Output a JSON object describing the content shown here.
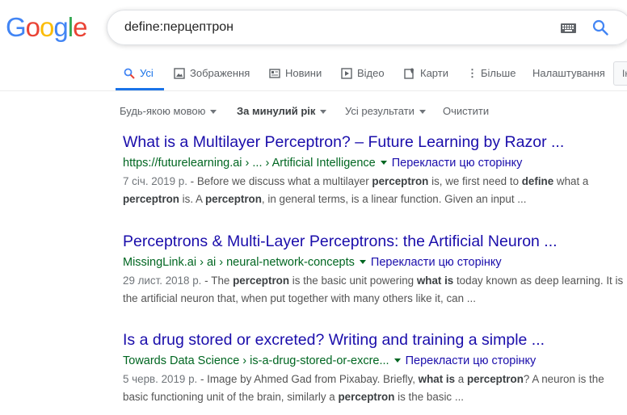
{
  "logo": [
    "G",
    "o",
    "o",
    "g",
    "l",
    "e"
  ],
  "logo_colors": [
    "#4285F4",
    "#EA4335",
    "#FBBC05",
    "#4285F4",
    "#34A853",
    "#EA4335"
  ],
  "search": {
    "query": "define:перцептрон"
  },
  "tabs": {
    "all": "Усі",
    "images": "Зображення",
    "news": "Новини",
    "video": "Відео",
    "maps": "Карти",
    "more": "Більше",
    "settings": "Налаштування",
    "tools": "Ін"
  },
  "filters": {
    "language": "Будь-якою мовою",
    "period": "За минулий рік",
    "results": "Усі результати",
    "clear": "Очистити"
  },
  "results": [
    {
      "title": "What is a Multilayer Perceptron? – Future Learning by Razor ...",
      "url": "https://futurelearning.ai › ... › Artificial Intelligence",
      "translate": "Перекласти цю сторінку",
      "date": "7 січ. 2019 р.",
      "snippet": [
        {
          "t": " - Before we discuss what a multilayer ",
          "b": false
        },
        {
          "t": "perceptron",
          "b": true
        },
        {
          "t": " is, we first need to ",
          "b": false
        },
        {
          "t": "define",
          "b": true
        },
        {
          "t": " what a ",
          "b": false
        },
        {
          "t": "perceptron",
          "b": true
        },
        {
          "t": " is. A ",
          "b": false
        },
        {
          "t": "perceptron",
          "b": true
        },
        {
          "t": ", in general terms, is a linear function. Given an input ...",
          "b": false
        }
      ]
    },
    {
      "title": "Perceptrons & Multi-Layer Perceptrons: the Artificial Neuron ...",
      "url": "MissingLink.ai › ai › neural-network-concepts",
      "translate": "Перекласти цю сторінку",
      "date": "29 лист. 2018 р.",
      "snippet": [
        {
          "t": " - The ",
          "b": false
        },
        {
          "t": "perceptron",
          "b": true
        },
        {
          "t": " is the basic unit powering ",
          "b": false
        },
        {
          "t": "what is",
          "b": true
        },
        {
          "t": " today known as deep learning. It is the artificial neuron that, when put together with many others like it, can ...",
          "b": false
        }
      ]
    },
    {
      "title": "Is a drug stored or excreted? Writing and training a simple ...",
      "url": "Towards Data Science › is-a-drug-stored-or-excre...",
      "translate": "Перекласти цю сторінку",
      "date": "5 черв. 2019 р.",
      "snippet": [
        {
          "t": " - Image by Ahmed Gad from Pixabay. Briefly, ",
          "b": false
        },
        {
          "t": "what is",
          "b": true
        },
        {
          "t": " a ",
          "b": false
        },
        {
          "t": "perceptron",
          "b": true
        },
        {
          "t": "? A neuron is the basic functioning unit of the brain, similarly a ",
          "b": false
        },
        {
          "t": "perceptron",
          "b": true
        },
        {
          "t": " is the basic ...",
          "b": false
        }
      ]
    }
  ]
}
